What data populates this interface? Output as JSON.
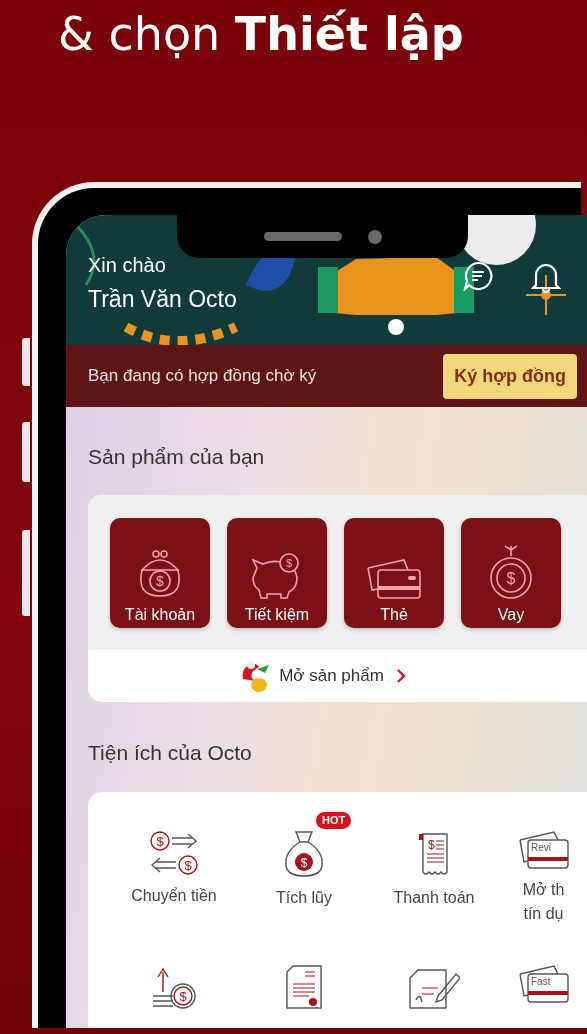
{
  "headline": "& chọn **Thiết lập**",
  "header": {
    "greeting": "Xin chào",
    "user_name": "Trần Văn Octo"
  },
  "contract_banner": {
    "message": "Bạn đang có hợp đồng chờ ký",
    "button": "Ký hợp đồng"
  },
  "products": {
    "title": "Sản phẩm của bạn",
    "open_link": "Mở sản phẩm",
    "items": [
      {
        "label": "Tài khoản",
        "kind": "purse",
        "icon_symbols": [
          "$"
        ]
      },
      {
        "label": "Tiết kiệm",
        "kind": "piggy",
        "icon_symbols": [
          "$"
        ]
      },
      {
        "label": "Thẻ",
        "kind": "cards"
      },
      {
        "label": "Vay",
        "kind": "coin",
        "icon_symbols": [
          "$"
        ]
      }
    ]
  },
  "utilities": {
    "title": "Tiện ích của Octo",
    "items": [
      {
        "label": "Chuyển tiền",
        "kind": "transfer",
        "icon_symbols": [
          "$",
          "$"
        ]
      },
      {
        "label": "Tích lũy",
        "kind": "moneybag",
        "badge": "HOT",
        "icon_symbols": [
          "$"
        ]
      },
      {
        "label": "Thanh toán",
        "kind": "bill",
        "icon_symbols": [
          "$"
        ]
      },
      {
        "label": "Mở th\ntín dụ",
        "kind": "card",
        "icon_text": "Revi"
      },
      {
        "kind": "invest",
        "icon_symbols": [
          "$"
        ]
      },
      {
        "kind": "document"
      },
      {
        "kind": "sign"
      },
      {
        "kind": "card",
        "icon_text": "Fast"
      }
    ]
  }
}
